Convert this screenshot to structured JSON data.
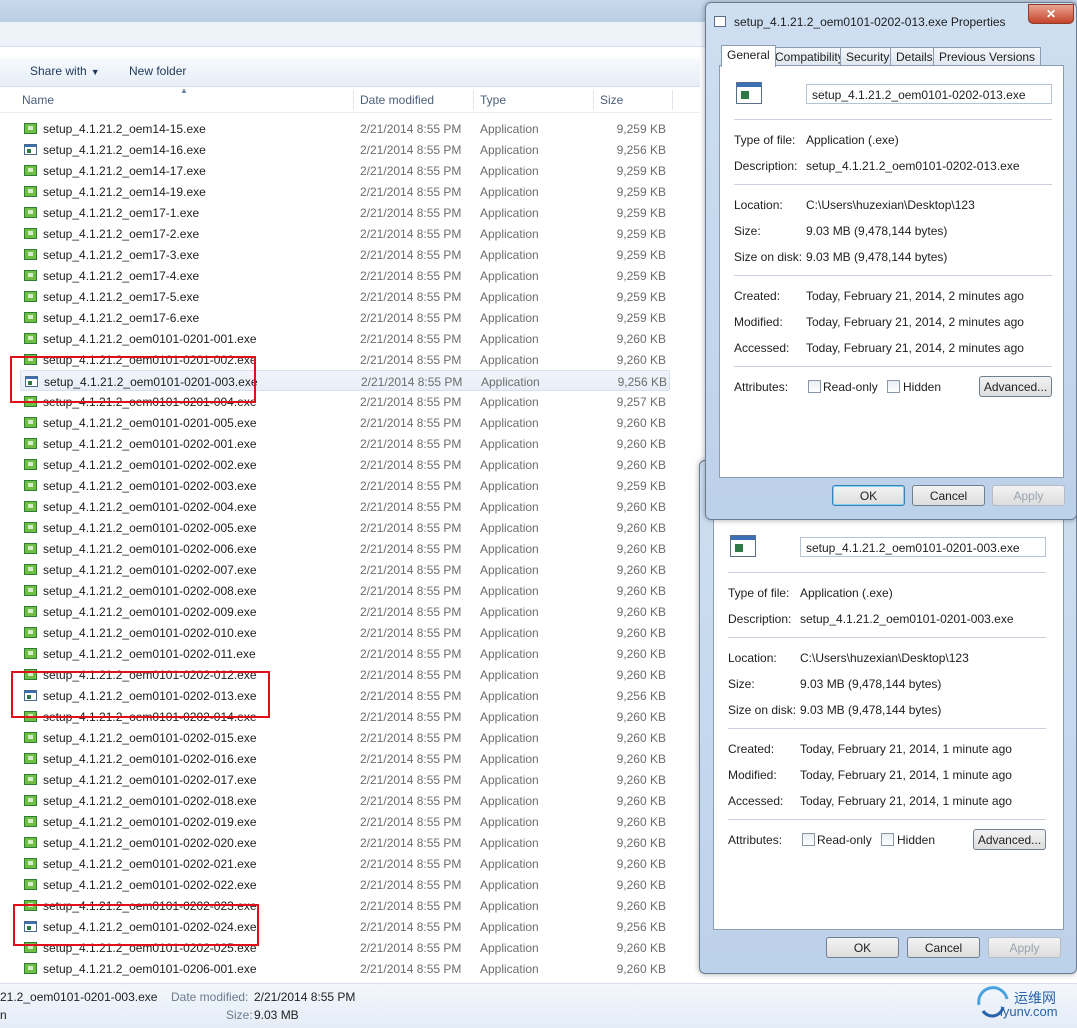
{
  "explorer": {
    "toolbar": {
      "share_with": "Share with",
      "new_folder": "New folder"
    },
    "columns": {
      "name": "Name",
      "date": "Date modified",
      "type": "Type",
      "size": "Size"
    },
    "files": [
      {
        "name": "setup_4.1.21.2_oem14-15.exe",
        "date": "2/21/2014 8:55 PM",
        "type": "Application",
        "size": "9,259 KB",
        "icon": "setup"
      },
      {
        "name": "setup_4.1.21.2_oem14-16.exe",
        "date": "2/21/2014 8:55 PM",
        "type": "Application",
        "size": "9,256 KB",
        "icon": "app"
      },
      {
        "name": "setup_4.1.21.2_oem14-17.exe",
        "date": "2/21/2014 8:55 PM",
        "type": "Application",
        "size": "9,259 KB",
        "icon": "setup"
      },
      {
        "name": "setup_4.1.21.2_oem14-19.exe",
        "date": "2/21/2014 8:55 PM",
        "type": "Application",
        "size": "9,259 KB",
        "icon": "setup"
      },
      {
        "name": "setup_4.1.21.2_oem17-1.exe",
        "date": "2/21/2014 8:55 PM",
        "type": "Application",
        "size": "9,259 KB",
        "icon": "setup"
      },
      {
        "name": "setup_4.1.21.2_oem17-2.exe",
        "date": "2/21/2014 8:55 PM",
        "type": "Application",
        "size": "9,259 KB",
        "icon": "setup"
      },
      {
        "name": "setup_4.1.21.2_oem17-3.exe",
        "date": "2/21/2014 8:55 PM",
        "type": "Application",
        "size": "9,259 KB",
        "icon": "setup"
      },
      {
        "name": "setup_4.1.21.2_oem17-4.exe",
        "date": "2/21/2014 8:55 PM",
        "type": "Application",
        "size": "9,259 KB",
        "icon": "setup"
      },
      {
        "name": "setup_4.1.21.2_oem17-5.exe",
        "date": "2/21/2014 8:55 PM",
        "type": "Application",
        "size": "9,259 KB",
        "icon": "setup"
      },
      {
        "name": "setup_4.1.21.2_oem17-6.exe",
        "date": "2/21/2014 8:55 PM",
        "type": "Application",
        "size": "9,259 KB",
        "icon": "setup"
      },
      {
        "name": "setup_4.1.21.2_oem0101-0201-001.exe",
        "date": "2/21/2014 8:55 PM",
        "type": "Application",
        "size": "9,260 KB",
        "icon": "setup"
      },
      {
        "name": "setup_4.1.21.2_oem0101-0201-002.exe",
        "date": "2/21/2014 8:55 PM",
        "type": "Application",
        "size": "9,260 KB",
        "icon": "setup"
      },
      {
        "name": "setup_4.1.21.2_oem0101-0201-003.exe",
        "date": "2/21/2014 8:55 PM",
        "type": "Application",
        "size": "9,256 KB",
        "icon": "app",
        "selected": true
      },
      {
        "name": "setup_4.1.21.2_oem0101-0201-004.exe",
        "date": "2/21/2014 8:55 PM",
        "type": "Application",
        "size": "9,257 KB",
        "icon": "setup"
      },
      {
        "name": "setup_4.1.21.2_oem0101-0201-005.exe",
        "date": "2/21/2014 8:55 PM",
        "type": "Application",
        "size": "9,260 KB",
        "icon": "setup"
      },
      {
        "name": "setup_4.1.21.2_oem0101-0202-001.exe",
        "date": "2/21/2014 8:55 PM",
        "type": "Application",
        "size": "9,260 KB",
        "icon": "setup"
      },
      {
        "name": "setup_4.1.21.2_oem0101-0202-002.exe",
        "date": "2/21/2014 8:55 PM",
        "type": "Application",
        "size": "9,260 KB",
        "icon": "setup"
      },
      {
        "name": "setup_4.1.21.2_oem0101-0202-003.exe",
        "date": "2/21/2014 8:55 PM",
        "type": "Application",
        "size": "9,259 KB",
        "icon": "setup"
      },
      {
        "name": "setup_4.1.21.2_oem0101-0202-004.exe",
        "date": "2/21/2014 8:55 PM",
        "type": "Application",
        "size": "9,260 KB",
        "icon": "setup"
      },
      {
        "name": "setup_4.1.21.2_oem0101-0202-005.exe",
        "date": "2/21/2014 8:55 PM",
        "type": "Application",
        "size": "9,260 KB",
        "icon": "setup"
      },
      {
        "name": "setup_4.1.21.2_oem0101-0202-006.exe",
        "date": "2/21/2014 8:55 PM",
        "type": "Application",
        "size": "9,260 KB",
        "icon": "setup"
      },
      {
        "name": "setup_4.1.21.2_oem0101-0202-007.exe",
        "date": "2/21/2014 8:55 PM",
        "type": "Application",
        "size": "9,260 KB",
        "icon": "setup"
      },
      {
        "name": "setup_4.1.21.2_oem0101-0202-008.exe",
        "date": "2/21/2014 8:55 PM",
        "type": "Application",
        "size": "9,260 KB",
        "icon": "setup"
      },
      {
        "name": "setup_4.1.21.2_oem0101-0202-009.exe",
        "date": "2/21/2014 8:55 PM",
        "type": "Application",
        "size": "9,260 KB",
        "icon": "setup"
      },
      {
        "name": "setup_4.1.21.2_oem0101-0202-010.exe",
        "date": "2/21/2014 8:55 PM",
        "type": "Application",
        "size": "9,260 KB",
        "icon": "setup"
      },
      {
        "name": "setup_4.1.21.2_oem0101-0202-011.exe",
        "date": "2/21/2014 8:55 PM",
        "type": "Application",
        "size": "9,260 KB",
        "icon": "setup"
      },
      {
        "name": "setup_4.1.21.2_oem0101-0202-012.exe",
        "date": "2/21/2014 8:55 PM",
        "type": "Application",
        "size": "9,260 KB",
        "icon": "setup"
      },
      {
        "name": "setup_4.1.21.2_oem0101-0202-013.exe",
        "date": "2/21/2014 8:55 PM",
        "type": "Application",
        "size": "9,256 KB",
        "icon": "app"
      },
      {
        "name": "setup_4.1.21.2_oem0101-0202-014.exe",
        "date": "2/21/2014 8:55 PM",
        "type": "Application",
        "size": "9,260 KB",
        "icon": "setup"
      },
      {
        "name": "setup_4.1.21.2_oem0101-0202-015.exe",
        "date": "2/21/2014 8:55 PM",
        "type": "Application",
        "size": "9,260 KB",
        "icon": "setup"
      },
      {
        "name": "setup_4.1.21.2_oem0101-0202-016.exe",
        "date": "2/21/2014 8:55 PM",
        "type": "Application",
        "size": "9,260 KB",
        "icon": "setup"
      },
      {
        "name": "setup_4.1.21.2_oem0101-0202-017.exe",
        "date": "2/21/2014 8:55 PM",
        "type": "Application",
        "size": "9,260 KB",
        "icon": "setup"
      },
      {
        "name": "setup_4.1.21.2_oem0101-0202-018.exe",
        "date": "2/21/2014 8:55 PM",
        "type": "Application",
        "size": "9,260 KB",
        "icon": "setup"
      },
      {
        "name": "setup_4.1.21.2_oem0101-0202-019.exe",
        "date": "2/21/2014 8:55 PM",
        "type": "Application",
        "size": "9,260 KB",
        "icon": "setup"
      },
      {
        "name": "setup_4.1.21.2_oem0101-0202-020.exe",
        "date": "2/21/2014 8:55 PM",
        "type": "Application",
        "size": "9,260 KB",
        "icon": "setup"
      },
      {
        "name": "setup_4.1.21.2_oem0101-0202-021.exe",
        "date": "2/21/2014 8:55 PM",
        "type": "Application",
        "size": "9,260 KB",
        "icon": "setup"
      },
      {
        "name": "setup_4.1.21.2_oem0101-0202-022.exe",
        "date": "2/21/2014 8:55 PM",
        "type": "Application",
        "size": "9,260 KB",
        "icon": "setup"
      },
      {
        "name": "setup_4.1.21.2_oem0101-0202-023.exe",
        "date": "2/21/2014 8:55 PM",
        "type": "Application",
        "size": "9,260 KB",
        "icon": "setup"
      },
      {
        "name": "setup_4.1.21.2_oem0101-0202-024.exe",
        "date": "2/21/2014 8:55 PM",
        "type": "Application",
        "size": "9,256 KB",
        "icon": "app"
      },
      {
        "name": "setup_4.1.21.2_oem0101-0202-025.exe",
        "date": "2/21/2014 8:55 PM",
        "type": "Application",
        "size": "9,260 KB",
        "icon": "setup"
      },
      {
        "name": "setup_4.1.21.2_oem0101-0206-001.exe",
        "date": "2/21/2014 8:55 PM",
        "type": "Application",
        "size": "9,260 KB",
        "icon": "setup"
      }
    ],
    "status": {
      "name": "21.2_oem0101-0201-003.exe",
      "date_label": "Date modified:",
      "date_value": "2/21/2014 8:55 PM",
      "size_label": "Size:",
      "size_value": "9.03 MB",
      "left_fragment": "n"
    }
  },
  "dialog_front": {
    "title": "setup_4.1.21.2_oem0101-0202-013.exe Properties",
    "close": "✕",
    "tabs": [
      "General",
      "Compatibility",
      "Security",
      "Details",
      "Previous Versions"
    ],
    "filename": "setup_4.1.21.2_oem0101-0202-013.exe",
    "type_label": "Type of file:",
    "type_value": "Application (.exe)",
    "desc_label": "Description:",
    "desc_value": "setup_4.1.21.2_oem0101-0202-013.exe",
    "loc_label": "Location:",
    "loc_value": "C:\\Users\\huzexian\\Desktop\\123",
    "size_label": "Size:",
    "size_value": "9.03 MB (9,478,144 bytes)",
    "disk_label": "Size on disk:",
    "disk_value": "9.03 MB (9,478,144 bytes)",
    "created_label": "Created:",
    "created_value": "Today, February 21, 2014, 2 minutes ago",
    "modified_label": "Modified:",
    "modified_value": "Today, February 21, 2014, 2 minutes ago",
    "accessed_label": "Accessed:",
    "accessed_value": "Today, February 21, 2014, 2 minutes ago",
    "attr_label": "Attributes:",
    "readonly": "Read-only",
    "hidden": "Hidden",
    "advanced": "Advanced...",
    "ok": "OK",
    "cancel": "Cancel",
    "apply": "Apply"
  },
  "dialog_back": {
    "filename": "setup_4.1.21.2_oem0101-0201-003.exe",
    "type_label": "Type of file:",
    "type_value": "Application (.exe)",
    "desc_label": "Description:",
    "desc_value": "setup_4.1.21.2_oem0101-0201-003.exe",
    "loc_label": "Location:",
    "loc_value": "C:\\Users\\huzexian\\Desktop\\123",
    "size_label": "Size:",
    "size_value": "9.03 MB (9,478,144 bytes)",
    "disk_label": "Size on disk:",
    "disk_value": "9.03 MB (9,478,144 bytes)",
    "created_label": "Created:",
    "created_value": "Today, February 21, 2014, 1 minute ago",
    "modified_label": "Modified:",
    "modified_value": "Today, February 21, 2014, 1 minute ago",
    "accessed_label": "Accessed:",
    "accessed_value": "Today, February 21, 2014, 1 minute ago",
    "attr_label": "Attributes:",
    "readonly": "Read-only",
    "hidden": "Hidden",
    "advanced": "Advanced...",
    "ok": "OK",
    "cancel": "Cancel",
    "apply": "Apply"
  },
  "watermark": {
    "cn": "运维网",
    "en": "iyunv.com"
  }
}
